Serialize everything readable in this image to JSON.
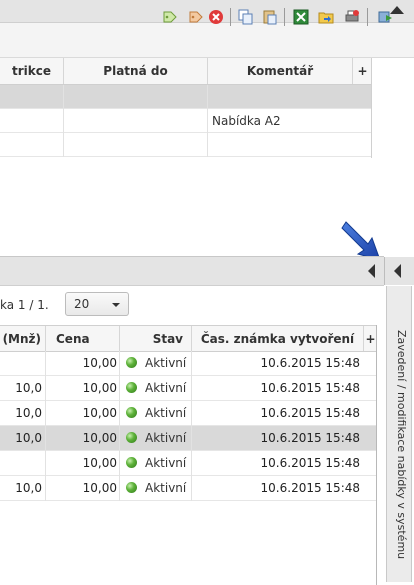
{
  "toolbar": {
    "icons": [
      "tag-add-icon",
      "tag-remove-icon",
      "delete-icon",
      "copy-icon",
      "paste-icon",
      "excel-export-icon",
      "open-folder-icon",
      "print-icon",
      "refresh-icon"
    ]
  },
  "upper_table": {
    "columns": [
      "trikce",
      "Platná do",
      "Komentář"
    ],
    "column_add": "+",
    "rows": [
      {
        "komentar": ""
      },
      {
        "komentar": "Nabídka A2"
      },
      {
        "komentar": ""
      }
    ]
  },
  "pager": {
    "label": "ka 1 / 1.",
    "page_size": "20"
  },
  "lower_table": {
    "columns": [
      "(Mnž)",
      "Cena",
      "Stav",
      "Čas. známka vytvoření"
    ],
    "column_add": "+",
    "rows": [
      {
        "mnz": "",
        "cena": "10,00",
        "stav": "Aktivní",
        "cas": "10.6.2015 15:48",
        "selected": false
      },
      {
        "mnz": "10,0",
        "cena": "10,00",
        "stav": "Aktivní",
        "cas": "10.6.2015 15:48",
        "selected": false
      },
      {
        "mnz": "10,0",
        "cena": "10,00",
        "stav": "Aktivní",
        "cas": "10.6.2015 15:48",
        "selected": false
      },
      {
        "mnz": "10,0",
        "cena": "10,00",
        "stav": "Aktivní",
        "cas": "10.6.2015 15:48",
        "selected": true
      },
      {
        "mnz": "",
        "cena": "10,00",
        "stav": "Aktivní",
        "cas": "10.6.2015 15:48",
        "selected": false
      },
      {
        "mnz": "10,0",
        "cena": "10,00",
        "stav": "Aktivní",
        "cas": "10.6.2015 15:48",
        "selected": false
      }
    ]
  },
  "side_panel": {
    "title": "Zavedení / modifikace nabídky v systému"
  },
  "colors": {
    "status_green": "#5fb33b",
    "selected_row": "#d9d9d9",
    "annotation_arrow": "#1f4fbf"
  }
}
